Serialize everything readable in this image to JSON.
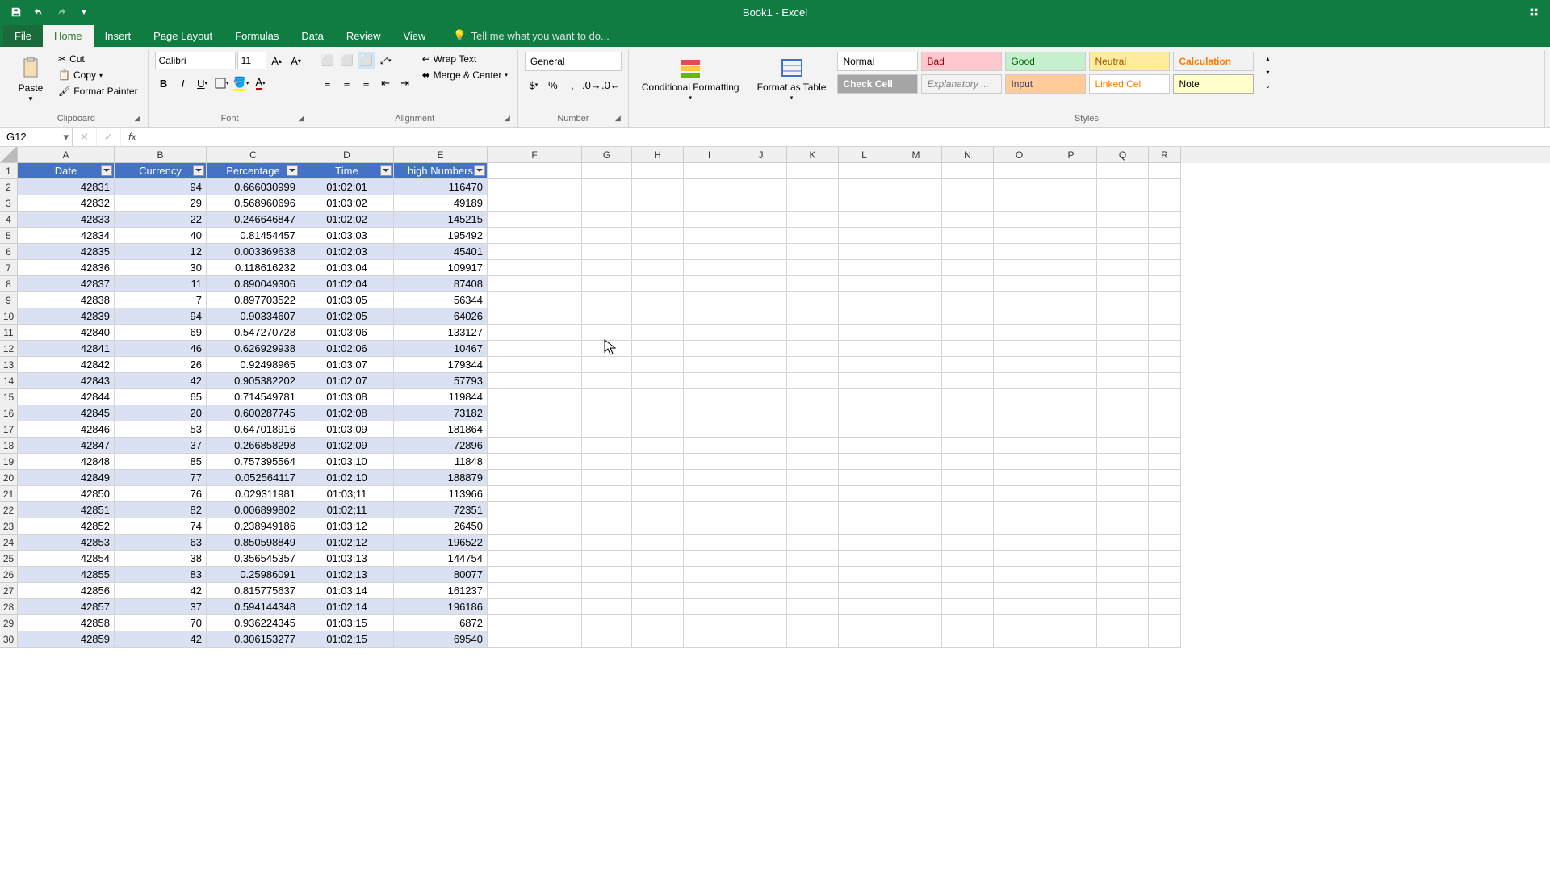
{
  "titlebar": {
    "title": "Book1 - Excel"
  },
  "tabs": [
    "File",
    "Home",
    "Insert",
    "Page Layout",
    "Formulas",
    "Data",
    "Review",
    "View"
  ],
  "tell_me": "Tell me what you want to do...",
  "clipboard": {
    "paste": "Paste",
    "cut": "Cut",
    "copy": "Copy",
    "format_painter": "Format Painter",
    "label": "Clipboard"
  },
  "font": {
    "name": "Calibri",
    "size": "11",
    "label": "Font"
  },
  "alignment": {
    "wrap": "Wrap Text",
    "merge": "Merge & Center",
    "label": "Alignment"
  },
  "number": {
    "format": "General",
    "label": "Number"
  },
  "styles": {
    "cond_fmt": "Conditional Formatting",
    "fmt_table": "Format as Table",
    "normal": "Normal",
    "bad": "Bad",
    "good": "Good",
    "neutral": "Neutral",
    "calc": "Calculation",
    "check": "Check Cell",
    "explan": "Explanatory ...",
    "input": "Input",
    "linked": "Linked Cell",
    "note": "Note",
    "label": "Styles"
  },
  "namebox": "G12",
  "columns": [
    "A",
    "B",
    "C",
    "D",
    "E",
    "F",
    "G",
    "H",
    "I",
    "J",
    "K",
    "L",
    "M",
    "N",
    "O",
    "P",
    "Q",
    "R"
  ],
  "col_widths": [
    "A",
    "B",
    "C",
    "D",
    "E",
    "F",
    "G",
    "H",
    "I",
    "J",
    "K",
    "L",
    "M",
    "N",
    "O",
    "P",
    "Q",
    "R"
  ],
  "row_nums": [
    1,
    2,
    3,
    4,
    5,
    6,
    7,
    8,
    9,
    10,
    11,
    12,
    13,
    14,
    15,
    16,
    17,
    18,
    19,
    20,
    21,
    22,
    23,
    24,
    25,
    26,
    27,
    28,
    29,
    30
  ],
  "table": {
    "headers": [
      "Date",
      "Currency",
      "Percentage",
      "Time",
      "high Numbers"
    ],
    "rows": [
      [
        "42831",
        "94",
        "0.666030999",
        "01:02;01",
        "116470"
      ],
      [
        "42832",
        "29",
        "0.568960696",
        "01:03;02",
        "49189"
      ],
      [
        "42833",
        "22",
        "0.246646847",
        "01:02;02",
        "145215"
      ],
      [
        "42834",
        "40",
        "0.81454457",
        "01:03;03",
        "195492"
      ],
      [
        "42835",
        "12",
        "0.003369638",
        "01:02;03",
        "45401"
      ],
      [
        "42836",
        "30",
        "0.118616232",
        "01:03;04",
        "109917"
      ],
      [
        "42837",
        "11",
        "0.890049306",
        "01:02;04",
        "87408"
      ],
      [
        "42838",
        "7",
        "0.897703522",
        "01:03;05",
        "56344"
      ],
      [
        "42839",
        "94",
        "0.90334607",
        "01:02;05",
        "64026"
      ],
      [
        "42840",
        "69",
        "0.547270728",
        "01:03;06",
        "133127"
      ],
      [
        "42841",
        "46",
        "0.626929938",
        "01:02;06",
        "10467"
      ],
      [
        "42842",
        "26",
        "0.92498965",
        "01:03;07",
        "179344"
      ],
      [
        "42843",
        "42",
        "0.905382202",
        "01:02;07",
        "57793"
      ],
      [
        "42844",
        "65",
        "0.714549781",
        "01:03;08",
        "119844"
      ],
      [
        "42845",
        "20",
        "0.600287745",
        "01:02;08",
        "73182"
      ],
      [
        "42846",
        "53",
        "0.647018916",
        "01:03;09",
        "181864"
      ],
      [
        "42847",
        "37",
        "0.266858298",
        "01:02;09",
        "72896"
      ],
      [
        "42848",
        "85",
        "0.757395564",
        "01:03;10",
        "11848"
      ],
      [
        "42849",
        "77",
        "0.052564117",
        "01:02;10",
        "188879"
      ],
      [
        "42850",
        "76",
        "0.029311981",
        "01:03;11",
        "113966"
      ],
      [
        "42851",
        "82",
        "0.006899802",
        "01:02;11",
        "72351"
      ],
      [
        "42852",
        "74",
        "0.238949186",
        "01:03;12",
        "26450"
      ],
      [
        "42853",
        "63",
        "0.850598849",
        "01:02;12",
        "196522"
      ],
      [
        "42854",
        "38",
        "0.356545357",
        "01:03;13",
        "144754"
      ],
      [
        "42855",
        "83",
        "0.25986091",
        "01:02;13",
        "80077"
      ],
      [
        "42856",
        "42",
        "0.815775637",
        "01:03;14",
        "161237"
      ],
      [
        "42857",
        "37",
        "0.594144348",
        "01:02;14",
        "196186"
      ],
      [
        "42858",
        "70",
        "0.936224345",
        "01:03;15",
        "6872"
      ],
      [
        "42859",
        "42",
        "0.306153277",
        "01:02;15",
        "69540"
      ]
    ]
  }
}
